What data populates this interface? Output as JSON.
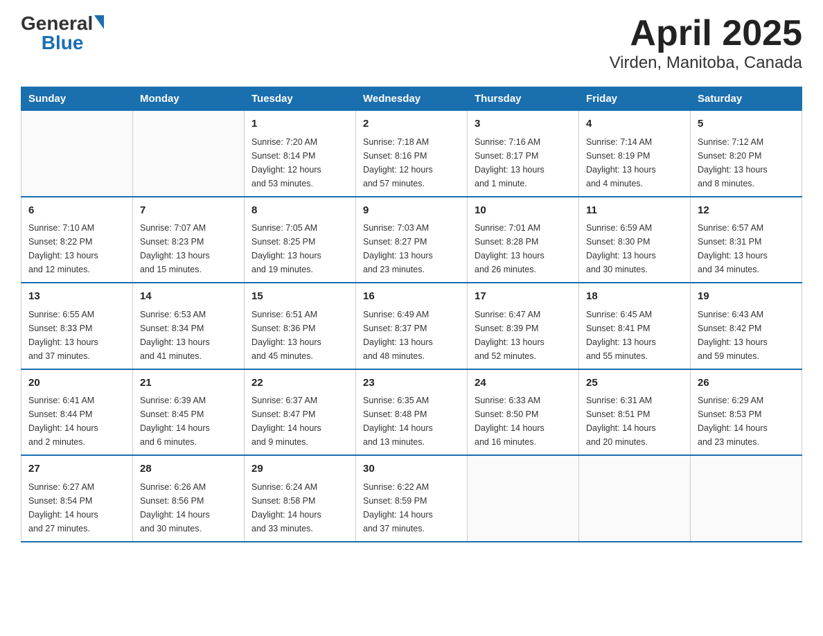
{
  "logo": {
    "text_general": "General",
    "text_blue": "Blue",
    "triangle": "▶"
  },
  "title": "April 2025",
  "subtitle": "Virden, Manitoba, Canada",
  "days_header": [
    "Sunday",
    "Monday",
    "Tuesday",
    "Wednesday",
    "Thursday",
    "Friday",
    "Saturday"
  ],
  "weeks": [
    [
      {
        "day": "",
        "info": ""
      },
      {
        "day": "",
        "info": ""
      },
      {
        "day": "1",
        "info": "Sunrise: 7:20 AM\nSunset: 8:14 PM\nDaylight: 12 hours\nand 53 minutes."
      },
      {
        "day": "2",
        "info": "Sunrise: 7:18 AM\nSunset: 8:16 PM\nDaylight: 12 hours\nand 57 minutes."
      },
      {
        "day": "3",
        "info": "Sunrise: 7:16 AM\nSunset: 8:17 PM\nDaylight: 13 hours\nand 1 minute."
      },
      {
        "day": "4",
        "info": "Sunrise: 7:14 AM\nSunset: 8:19 PM\nDaylight: 13 hours\nand 4 minutes."
      },
      {
        "day": "5",
        "info": "Sunrise: 7:12 AM\nSunset: 8:20 PM\nDaylight: 13 hours\nand 8 minutes."
      }
    ],
    [
      {
        "day": "6",
        "info": "Sunrise: 7:10 AM\nSunset: 8:22 PM\nDaylight: 13 hours\nand 12 minutes."
      },
      {
        "day": "7",
        "info": "Sunrise: 7:07 AM\nSunset: 8:23 PM\nDaylight: 13 hours\nand 15 minutes."
      },
      {
        "day": "8",
        "info": "Sunrise: 7:05 AM\nSunset: 8:25 PM\nDaylight: 13 hours\nand 19 minutes."
      },
      {
        "day": "9",
        "info": "Sunrise: 7:03 AM\nSunset: 8:27 PM\nDaylight: 13 hours\nand 23 minutes."
      },
      {
        "day": "10",
        "info": "Sunrise: 7:01 AM\nSunset: 8:28 PM\nDaylight: 13 hours\nand 26 minutes."
      },
      {
        "day": "11",
        "info": "Sunrise: 6:59 AM\nSunset: 8:30 PM\nDaylight: 13 hours\nand 30 minutes."
      },
      {
        "day": "12",
        "info": "Sunrise: 6:57 AM\nSunset: 8:31 PM\nDaylight: 13 hours\nand 34 minutes."
      }
    ],
    [
      {
        "day": "13",
        "info": "Sunrise: 6:55 AM\nSunset: 8:33 PM\nDaylight: 13 hours\nand 37 minutes."
      },
      {
        "day": "14",
        "info": "Sunrise: 6:53 AM\nSunset: 8:34 PM\nDaylight: 13 hours\nand 41 minutes."
      },
      {
        "day": "15",
        "info": "Sunrise: 6:51 AM\nSunset: 8:36 PM\nDaylight: 13 hours\nand 45 minutes."
      },
      {
        "day": "16",
        "info": "Sunrise: 6:49 AM\nSunset: 8:37 PM\nDaylight: 13 hours\nand 48 minutes."
      },
      {
        "day": "17",
        "info": "Sunrise: 6:47 AM\nSunset: 8:39 PM\nDaylight: 13 hours\nand 52 minutes."
      },
      {
        "day": "18",
        "info": "Sunrise: 6:45 AM\nSunset: 8:41 PM\nDaylight: 13 hours\nand 55 minutes."
      },
      {
        "day": "19",
        "info": "Sunrise: 6:43 AM\nSunset: 8:42 PM\nDaylight: 13 hours\nand 59 minutes."
      }
    ],
    [
      {
        "day": "20",
        "info": "Sunrise: 6:41 AM\nSunset: 8:44 PM\nDaylight: 14 hours\nand 2 minutes."
      },
      {
        "day": "21",
        "info": "Sunrise: 6:39 AM\nSunset: 8:45 PM\nDaylight: 14 hours\nand 6 minutes."
      },
      {
        "day": "22",
        "info": "Sunrise: 6:37 AM\nSunset: 8:47 PM\nDaylight: 14 hours\nand 9 minutes."
      },
      {
        "day": "23",
        "info": "Sunrise: 6:35 AM\nSunset: 8:48 PM\nDaylight: 14 hours\nand 13 minutes."
      },
      {
        "day": "24",
        "info": "Sunrise: 6:33 AM\nSunset: 8:50 PM\nDaylight: 14 hours\nand 16 minutes."
      },
      {
        "day": "25",
        "info": "Sunrise: 6:31 AM\nSunset: 8:51 PM\nDaylight: 14 hours\nand 20 minutes."
      },
      {
        "day": "26",
        "info": "Sunrise: 6:29 AM\nSunset: 8:53 PM\nDaylight: 14 hours\nand 23 minutes."
      }
    ],
    [
      {
        "day": "27",
        "info": "Sunrise: 6:27 AM\nSunset: 8:54 PM\nDaylight: 14 hours\nand 27 minutes."
      },
      {
        "day": "28",
        "info": "Sunrise: 6:26 AM\nSunset: 8:56 PM\nDaylight: 14 hours\nand 30 minutes."
      },
      {
        "day": "29",
        "info": "Sunrise: 6:24 AM\nSunset: 8:58 PM\nDaylight: 14 hours\nand 33 minutes."
      },
      {
        "day": "30",
        "info": "Sunrise: 6:22 AM\nSunset: 8:59 PM\nDaylight: 14 hours\nand 37 minutes."
      },
      {
        "day": "",
        "info": ""
      },
      {
        "day": "",
        "info": ""
      },
      {
        "day": "",
        "info": ""
      }
    ]
  ]
}
